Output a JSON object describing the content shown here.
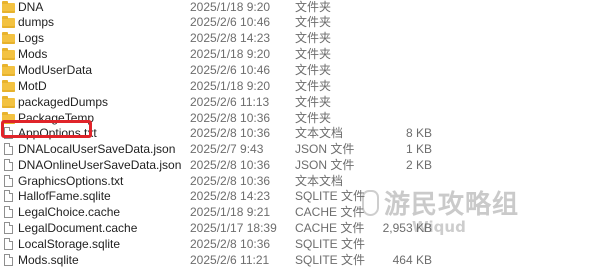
{
  "files": [
    {
      "name": "DNA",
      "date": "2025/1/18 9:20",
      "type": "文件夹",
      "size": "",
      "icon": "folder-icon"
    },
    {
      "name": "dumps",
      "date": "2025/2/6 10:46",
      "type": "文件夹",
      "size": "",
      "icon": "folder-icon"
    },
    {
      "name": "Logs",
      "date": "2025/2/8 14:23",
      "type": "文件夹",
      "size": "",
      "icon": "folder-icon"
    },
    {
      "name": "Mods",
      "date": "2025/1/18 9:20",
      "type": "文件夹",
      "size": "",
      "icon": "folder-icon"
    },
    {
      "name": "ModUserData",
      "date": "2025/2/6 10:46",
      "type": "文件夹",
      "size": "",
      "icon": "folder-icon"
    },
    {
      "name": "MotD",
      "date": "2025/1/18 9:20",
      "type": "文件夹",
      "size": "",
      "icon": "folder-icon"
    },
    {
      "name": "packagedDumps",
      "date": "2025/2/6 11:13",
      "type": "文件夹",
      "size": "",
      "icon": "folder-icon"
    },
    {
      "name": "PackageTemp",
      "date": "2025/2/8 10:36",
      "type": "文件夹",
      "size": "",
      "icon": "folder-icon"
    },
    {
      "name": "AppOptions.txt",
      "date": "2025/2/8 10:36",
      "type": "文本文档",
      "size": "8 KB",
      "icon": "text-document-icon"
    },
    {
      "name": "DNALocalUserSaveData.json",
      "date": "2025/2/7 9:43",
      "type": "JSON 文件",
      "size": "1 KB",
      "icon": "json-document-icon"
    },
    {
      "name": "DNAOnlineUserSaveData.json",
      "date": "2025/2/8 10:36",
      "type": "JSON 文件",
      "size": "2 KB",
      "icon": "json-document-icon"
    },
    {
      "name": "GraphicsOptions.txt",
      "date": "2025/2/8 10:36",
      "type": "文本文档",
      "size": "",
      "icon": "text-document-icon"
    },
    {
      "name": "HallofFame.sqlite",
      "date": "2025/2/8 14:23",
      "type": "SQLITE 文件",
      "size": "",
      "icon": "sqlite-document-icon"
    },
    {
      "name": "LegalChoice.cache",
      "date": "2025/1/18 9:21",
      "type": "CACHE 文件",
      "size": "",
      "icon": "cache-document-icon"
    },
    {
      "name": "LegalDocument.cache",
      "date": "2025/1/17 18:39",
      "type": "CACHE 文件",
      "size": "2,953 KB",
      "icon": "cache-document-icon"
    },
    {
      "name": "LocalStorage.sqlite",
      "date": "2025/2/8 10:36",
      "type": "SQLITE 文件",
      "size": "",
      "icon": "sqlite-document-icon"
    },
    {
      "name": "Mods.sqlite",
      "date": "2025/2/6 11:21",
      "type": "SQLITE 文件",
      "size": "464 KB",
      "icon": "sqlite-document-icon"
    }
  ],
  "highlight_color": "#e0242a",
  "folder_color": "#f3c241",
  "watermark": {
    "icon": "shield-logo-icon",
    "text": "游民攻略组",
    "sub": "Wiqud"
  }
}
